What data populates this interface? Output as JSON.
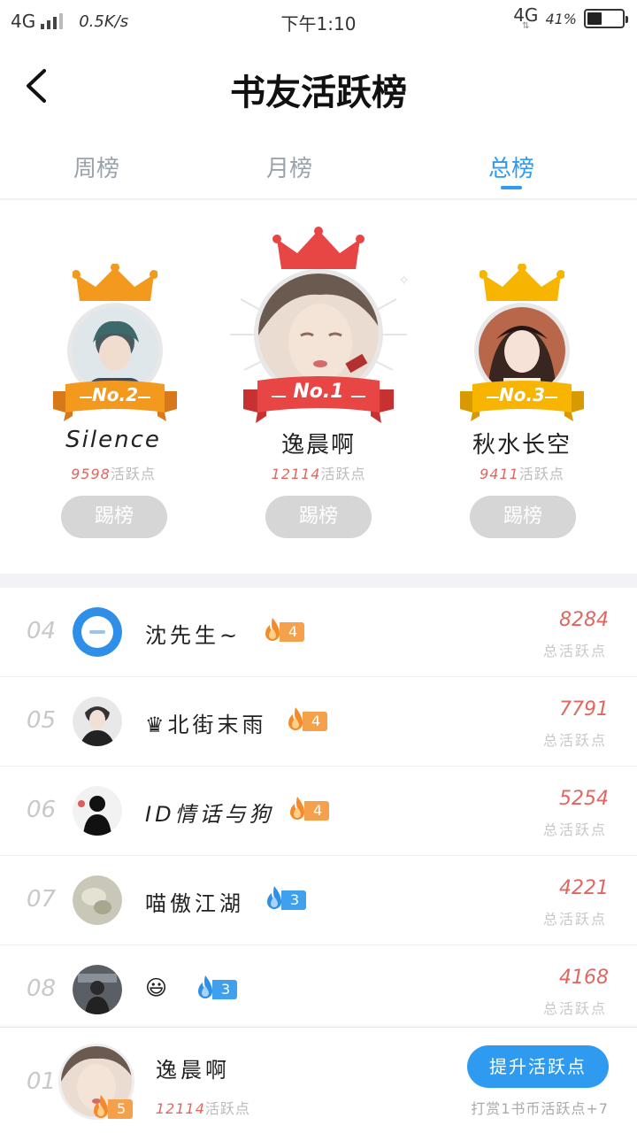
{
  "status_bar": {
    "network_left": "4G",
    "speed": "0.5K/s",
    "time": "下午1:10",
    "network_right": "4G",
    "battery_pct": "41%",
    "battery_level": 0.41
  },
  "header": {
    "title": "书友活跃榜"
  },
  "tabs": [
    {
      "label": "周榜",
      "active": false
    },
    {
      "label": "月榜",
      "active": false
    },
    {
      "label": "总榜",
      "active": true
    }
  ],
  "podium": {
    "first": {
      "badge": "No.1",
      "name": "逸晨啊",
      "points": "12114",
      "points_suffix": "活跃点",
      "button": "踢榜"
    },
    "second": {
      "badge": "No.2",
      "name": "Silence",
      "points": "9598",
      "points_suffix": "活跃点",
      "button": "踢榜"
    },
    "third": {
      "badge": "No.3",
      "name": "秋水长空",
      "points": "9411",
      "points_suffix": "活跃点",
      "button": "踢榜"
    }
  },
  "ranking": [
    {
      "rank": "04",
      "name": "沈先生~",
      "level": "4",
      "level_color": "orange",
      "score": "8284",
      "score_label": "总活跃点"
    },
    {
      "rank": "05",
      "name": "♛北街末雨",
      "level": "4",
      "level_color": "orange",
      "score": "7791",
      "score_label": "总活跃点"
    },
    {
      "rank": "06",
      "name": "ID情话与狗",
      "level": "4",
      "level_color": "orange",
      "score": "5254",
      "score_label": "总活跃点"
    },
    {
      "rank": "07",
      "name": "喵傲江湖",
      "level": "3",
      "level_color": "blue",
      "score": "4221",
      "score_label": "总活跃点"
    },
    {
      "rank": "08",
      "name": "😃",
      "level": "3",
      "level_color": "blue",
      "score": "4168",
      "score_label": "总活跃点"
    }
  ],
  "my_rank": {
    "rank": "01",
    "name": "逸晨啊",
    "level": "5",
    "points": "12114",
    "points_suffix": "活跃点",
    "boost_button": "提升活跃点",
    "reward_hint": "打赏1书币活跃点+7"
  },
  "colors": {
    "accent": "#2f9bf0",
    "score_red": "#e0675f",
    "gold": "#f7b400",
    "silver_orange": "#f39a1e",
    "first_red": "#e84545"
  }
}
